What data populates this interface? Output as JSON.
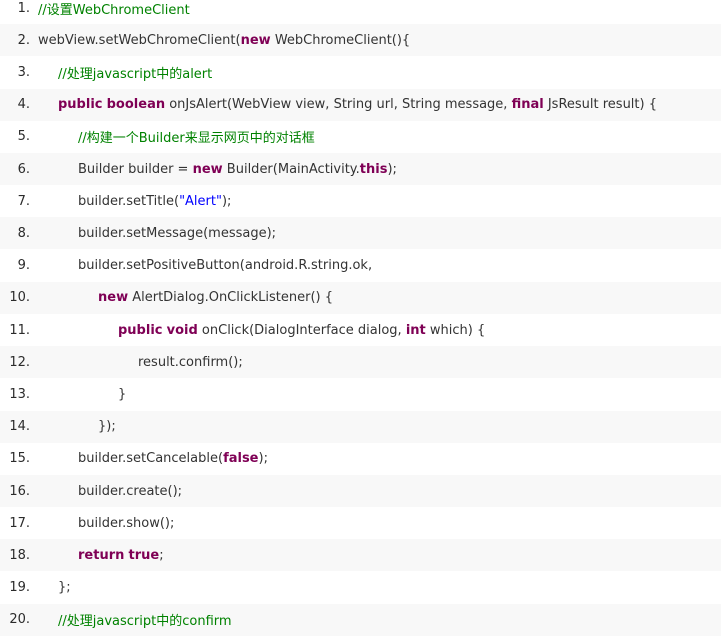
{
  "colors": {
    "comment": "#008200",
    "keyword": "#7f0055",
    "string": "#0000ff",
    "plain": "#333333",
    "stripe": "#f8f8f8"
  },
  "lines": [
    {
      "number": "1.",
      "indent": 0,
      "tokens": [
        {
          "t": "comment",
          "v": "//设置WebChromeClient"
        }
      ]
    },
    {
      "number": "2.",
      "indent": 0,
      "tokens": [
        {
          "t": "plain",
          "v": "webView.setWebChromeClient("
        },
        {
          "t": "keyword",
          "v": "new"
        },
        {
          "t": "plain",
          "v": " WebChromeClient(){"
        }
      ]
    },
    {
      "number": "3.",
      "indent": 1,
      "tokens": [
        {
          "t": "comment",
          "v": "//处理javascript中的alert"
        }
      ]
    },
    {
      "number": "4.",
      "indent": 1,
      "tokens": [
        {
          "t": "keyword",
          "v": "public"
        },
        {
          "t": "plain",
          "v": " "
        },
        {
          "t": "keyword",
          "v": "boolean"
        },
        {
          "t": "plain",
          "v": " onJsAlert(WebView view, String url, String message, "
        },
        {
          "t": "keyword",
          "v": "final"
        },
        {
          "t": "plain",
          "v": " JsResult result) {"
        }
      ]
    },
    {
      "number": "5.",
      "indent": 2,
      "tokens": [
        {
          "t": "comment",
          "v": "//构建一个Builder来显示网页中的对话框"
        }
      ]
    },
    {
      "number": "6.",
      "indent": 2,
      "tokens": [
        {
          "t": "plain",
          "v": "Builder builder = "
        },
        {
          "t": "keyword",
          "v": "new"
        },
        {
          "t": "plain",
          "v": " Builder(MainActivity."
        },
        {
          "t": "keyword",
          "v": "this"
        },
        {
          "t": "plain",
          "v": ");"
        }
      ]
    },
    {
      "number": "7.",
      "indent": 2,
      "tokens": [
        {
          "t": "plain",
          "v": "builder.setTitle("
        },
        {
          "t": "string",
          "v": "\"Alert\""
        },
        {
          "t": "plain",
          "v": ");"
        }
      ]
    },
    {
      "number": "8.",
      "indent": 2,
      "tokens": [
        {
          "t": "plain",
          "v": "builder.setMessage(message);"
        }
      ]
    },
    {
      "number": "9.",
      "indent": 2,
      "tokens": [
        {
          "t": "plain",
          "v": "builder.setPositiveButton(android.R.string.ok,"
        }
      ]
    },
    {
      "number": "10.",
      "indent": 3,
      "tokens": [
        {
          "t": "keyword",
          "v": "new"
        },
        {
          "t": "plain",
          "v": " AlertDialog.OnClickListener() {"
        }
      ]
    },
    {
      "number": "11.",
      "indent": 4,
      "tokens": [
        {
          "t": "keyword",
          "v": "public"
        },
        {
          "t": "plain",
          "v": " "
        },
        {
          "t": "keyword",
          "v": "void"
        },
        {
          "t": "plain",
          "v": " onClick(DialogInterface dialog, "
        },
        {
          "t": "keyword",
          "v": "int"
        },
        {
          "t": "plain",
          "v": " which) {"
        }
      ]
    },
    {
      "number": "12.",
      "indent": 5,
      "tokens": [
        {
          "t": "plain",
          "v": "result.confirm();"
        }
      ]
    },
    {
      "number": "13.",
      "indent": 4,
      "tokens": [
        {
          "t": "plain",
          "v": "}"
        }
      ]
    },
    {
      "number": "14.",
      "indent": 3,
      "tokens": [
        {
          "t": "plain",
          "v": "});"
        }
      ]
    },
    {
      "number": "15.",
      "indent": 2,
      "tokens": [
        {
          "t": "plain",
          "v": "builder.setCancelable("
        },
        {
          "t": "keyword",
          "v": "false"
        },
        {
          "t": "plain",
          "v": ");"
        }
      ]
    },
    {
      "number": "16.",
      "indent": 2,
      "tokens": [
        {
          "t": "plain",
          "v": "builder.create();"
        }
      ]
    },
    {
      "number": "17.",
      "indent": 2,
      "tokens": [
        {
          "t": "plain",
          "v": "builder.show();"
        }
      ]
    },
    {
      "number": "18.",
      "indent": 2,
      "tokens": [
        {
          "t": "keyword",
          "v": "return"
        },
        {
          "t": "plain",
          "v": " "
        },
        {
          "t": "keyword",
          "v": "true"
        },
        {
          "t": "plain",
          "v": ";"
        }
      ]
    },
    {
      "number": "19.",
      "indent": 1,
      "tokens": [
        {
          "t": "plain",
          "v": "};"
        }
      ]
    },
    {
      "number": "20.",
      "indent": 1,
      "tokens": [
        {
          "t": "comment",
          "v": "//处理javascript中的confirm"
        }
      ]
    }
  ]
}
